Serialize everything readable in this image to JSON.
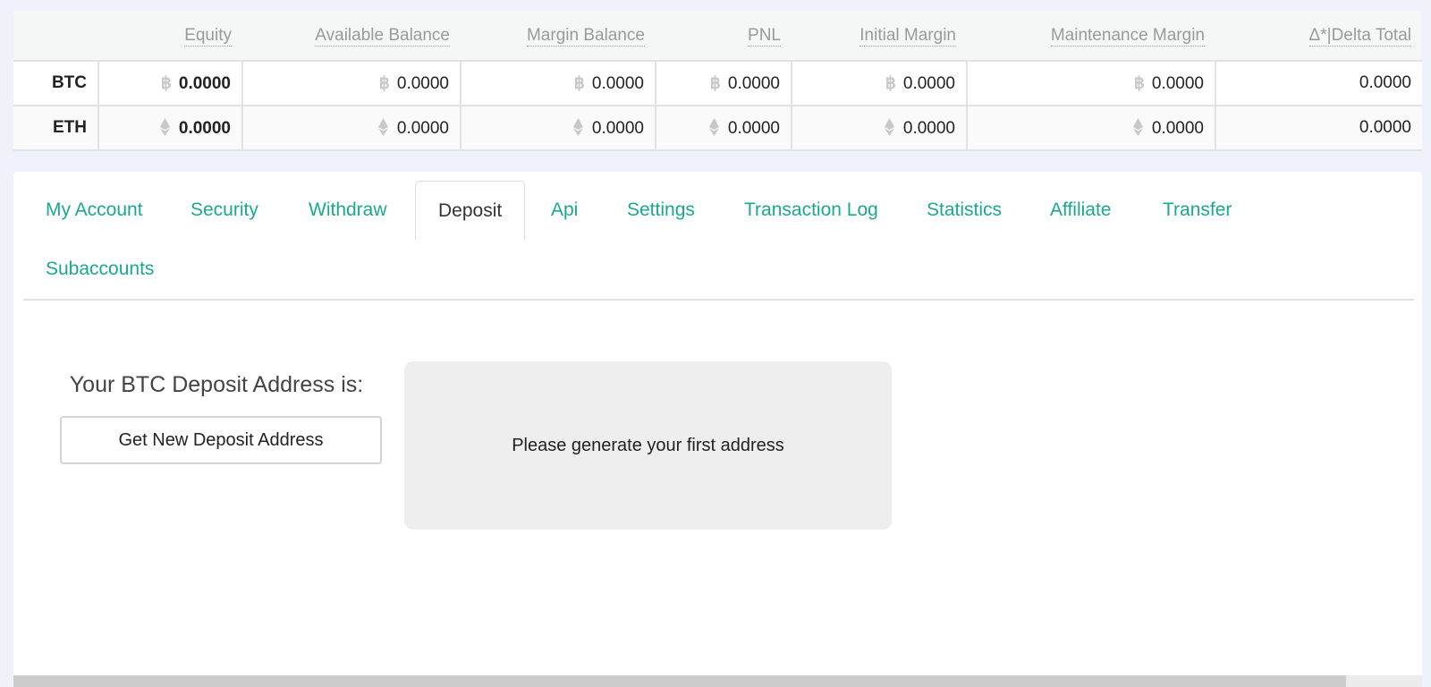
{
  "balances": {
    "columns": [
      "Equity",
      "Available Balance",
      "Margin Balance",
      "PNL",
      "Initial Margin",
      "Maintenance Margin",
      "Δ*|Delta Total"
    ],
    "rows": [
      {
        "currency": "BTC",
        "icon": "bitcoin-icon",
        "equity": "0.0000",
        "available_balance": "0.0000",
        "margin_balance": "0.0000",
        "pnl": "0.0000",
        "initial_margin": "0.0000",
        "maintenance_margin": "0.0000",
        "delta_total": "0.0000"
      },
      {
        "currency": "ETH",
        "icon": "ethereum-icon",
        "equity": "0.0000",
        "available_balance": "0.0000",
        "margin_balance": "0.0000",
        "pnl": "0.0000",
        "initial_margin": "0.0000",
        "maintenance_margin": "0.0000",
        "delta_total": "0.0000"
      }
    ],
    "btc_symbol": "฿"
  },
  "tabs": [
    {
      "label": "My Account"
    },
    {
      "label": "Security"
    },
    {
      "label": "Withdraw"
    },
    {
      "label": "Deposit",
      "active": true
    },
    {
      "label": "Api"
    },
    {
      "label": "Settings"
    },
    {
      "label": "Transaction Log"
    },
    {
      "label": "Statistics"
    },
    {
      "label": "Affiliate"
    },
    {
      "label": "Transfer"
    },
    {
      "label": "Subaccounts"
    }
  ],
  "deposit": {
    "address_label": "Your BTC Deposit Address is:",
    "get_address_button": "Get New Deposit Address",
    "address_placeholder": "Please generate your first address"
  },
  "colors": {
    "accent": "#1aa98e",
    "background": "#eff2fa"
  }
}
